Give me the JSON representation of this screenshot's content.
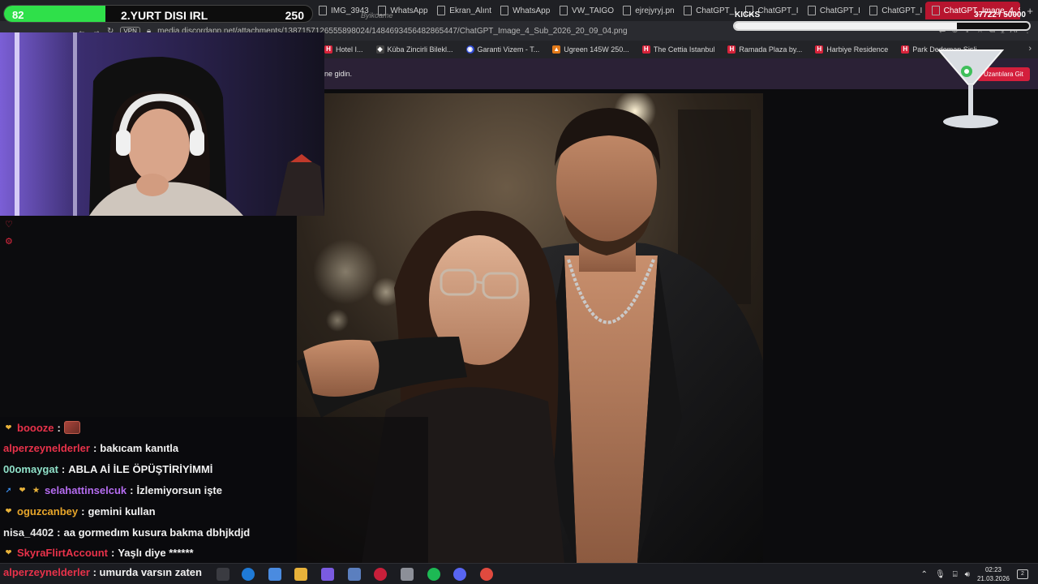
{
  "browser": {
    "tabs": [
      {
        "label": "IMG_3943",
        "active": false
      },
      {
        "label": "WhatsApp",
        "active": false
      },
      {
        "label": "Ekran_Alınt",
        "active": false
      },
      {
        "label": "WhatsApp",
        "active": false
      },
      {
        "label": "VW_TAIGO",
        "active": false
      },
      {
        "label": "ejrejyryj.pn",
        "active": false
      },
      {
        "label": "ChatGPT_I",
        "active": false
      },
      {
        "label": "ChatGPT_I",
        "active": false
      },
      {
        "label": "ChatGPT_I",
        "active": false
      },
      {
        "label": "ChatGPT_I",
        "active": false
      },
      {
        "label": "ChatGPT_Image_4_S",
        "active": true
      }
    ],
    "new_tab": "+",
    "vpn_label": "VPN",
    "url": "media.discordapp.net/attachments/1387157126555898024/1484693456482865447/ChatGPT_Image_4_Sub_2026_20_09_04.png",
    "bookmarks": [
      {
        "label": "Hotel I...",
        "icon": "hotel-icon"
      },
      {
        "label": "Küba Zincirli Bilekl...",
        "icon": "shop-icon"
      },
      {
        "label": "Garanti Vizem - T...",
        "icon": "globe-icon"
      },
      {
        "label": "Ugreen 145W 250...",
        "icon": "store-icon"
      },
      {
        "label": "The Cettia Istanbul",
        "icon": "hotel-icon"
      },
      {
        "label": "Ramada Plaza by...",
        "icon": "hotel-icon"
      },
      {
        "label": "Harbiye Residence",
        "icon": "hotel-icon"
      },
      {
        "label": "Park Dedeman Şişli",
        "icon": "hotel-icon"
      }
    ],
    "notice_text": "ne gidin.",
    "notice_button": "Uzantılara Git"
  },
  "stream": {
    "goal_value": "82",
    "goal_title": "2.YURT DISI IRL",
    "goal_target": "250",
    "goal_progress": 0.328,
    "watermark": "Byikoame",
    "kicks_label": "KICKS",
    "kicks_count": "37722 / 50000",
    "kicks_progress": 0.754
  },
  "chat": [
    {
      "user": "boooze",
      "color": "#e8324a",
      "message": "",
      "badges": [
        "heart-badge"
      ],
      "emote": true
    },
    {
      "user": "alperzeynelderler",
      "color": "#e8324a",
      "message": "bakıcam kanıtla",
      "badges": []
    },
    {
      "user": "00omaygat",
      "color": "#8fe0c8",
      "message": "ABLA Aİ İLE ÖPÜŞTİRİYİMMİ",
      "badges": []
    },
    {
      "user": "selahattinselcuk",
      "color": "#b56cf0",
      "message": "İzlemiyorsun işte",
      "badges": [
        "boost-badge",
        "heart-badge",
        "sub-badge"
      ]
    },
    {
      "user": "oguzcanbey",
      "color": "#e8a62a",
      "message": "gemini kullan",
      "badges": [
        "heart-badge"
      ]
    },
    {
      "user": "nisa_4402",
      "color": "#e6e6e6",
      "message": "aa gormedım kusura bakma dbhjkdjd",
      "badges": []
    },
    {
      "user": "SkyraFlirtAccount",
      "color": "#e8324a",
      "message": "Yaşlı diye ******",
      "badges": [
        "heart-badge"
      ]
    },
    {
      "user": "alperzeynelderler",
      "color": "#e8324a",
      "message": "umurda varsın zaten",
      "badges": []
    }
  ],
  "taskbar": {
    "time": "02:23",
    "date": "21.03.2026",
    "notifications": "2"
  }
}
